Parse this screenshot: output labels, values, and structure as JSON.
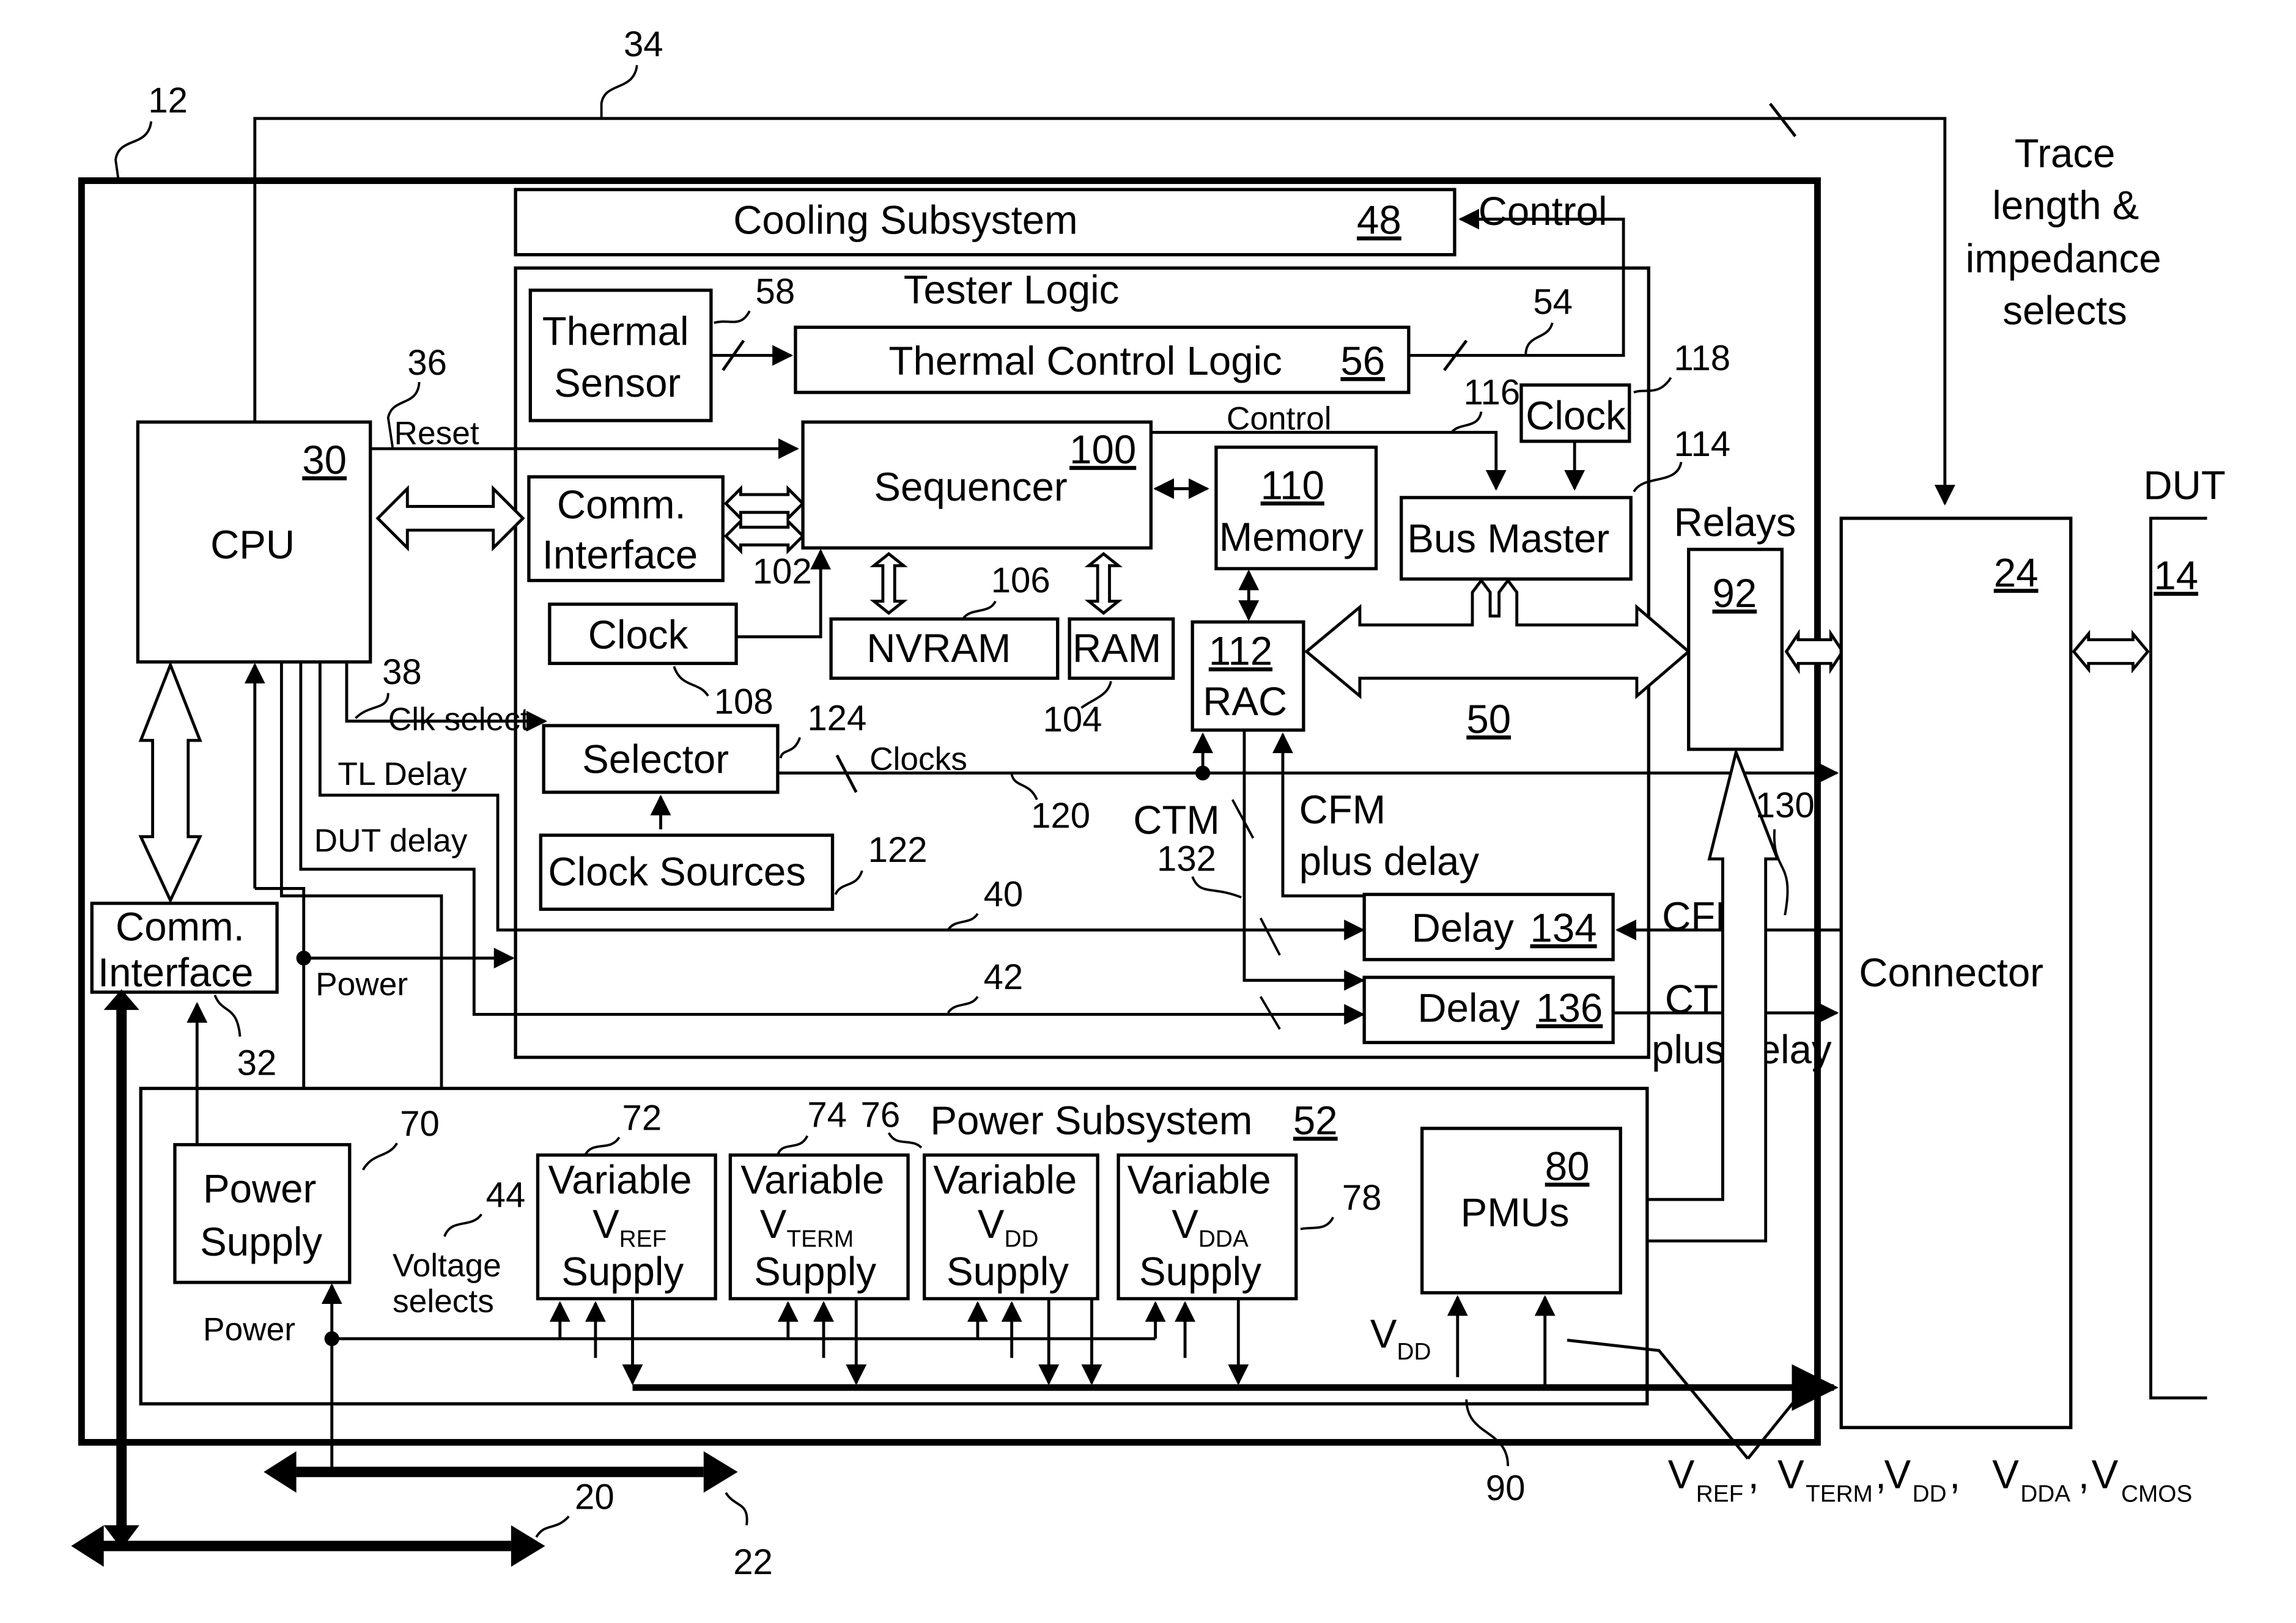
{
  "figure": {
    "refs": {
      "tester": "12",
      "trace_bus": "34",
      "cpu_reset": "36",
      "cpu_sel": "38",
      "tl_delay_line": "40",
      "dut_delay_line": "42",
      "voltage_sel": "44",
      "thermal_sensor": "58",
      "thermal_ctl_line": "54",
      "clock_bus_master": "118",
      "bus_master": "114",
      "control_116": "116",
      "comm_if_inner": "102",
      "nvram": "106",
      "clock_108": "108",
      "ram": "104",
      "selector": "124",
      "clocks_line": "120",
      "clock_sources": "122",
      "ctm_line": "132",
      "cfm_line": "130",
      "comm_if_outer": "32",
      "power_supply": "70",
      "vref": "72",
      "vterm": "74",
      "vdd": "76",
      "vdda": "78",
      "pmu_vdd": "90",
      "bus_a": "20",
      "bus_b": "22",
      "dut": "14"
    },
    "blocks": {
      "cooling": {
        "label": "Cooling Subsystem",
        "num": "48"
      },
      "tester_logic": {
        "label": "Tester Logic",
        "num": "50"
      },
      "thermal_sensor": {
        "line1": "Thermal",
        "line2": "Sensor"
      },
      "thermal_control": {
        "label": "Thermal Control Logic",
        "num": "56"
      },
      "cpu": {
        "label": "CPU",
        "num": "30"
      },
      "comm_inner": {
        "line1": "Comm.",
        "line2": "Interface"
      },
      "sequencer": {
        "label": "Sequencer",
        "num": "100"
      },
      "memory": {
        "label": "Memory",
        "num": "110"
      },
      "clock_bm": {
        "label": "Clock"
      },
      "bus_master": {
        "label": "Bus Master"
      },
      "clock_108": {
        "label": "Clock"
      },
      "nvram": {
        "label": "NVRAM"
      },
      "ram": {
        "label": "RAM"
      },
      "rac": {
        "label": "RAC",
        "num": "112"
      },
      "relays": {
        "label": "Relays",
        "num": "92"
      },
      "connector": {
        "label": "Connector",
        "num": "24"
      },
      "dut": {
        "label": "DUT",
        "num": "14"
      },
      "selector": {
        "label": "Selector"
      },
      "clock_sources": {
        "label": "Clock Sources"
      },
      "delay134": {
        "label": "Delay",
        "num": "134"
      },
      "delay136": {
        "label": "Delay",
        "num": "136"
      },
      "comm_outer": {
        "line1": "Comm.",
        "line2": "Interface"
      },
      "power_subsystem": {
        "label": "Power Subsystem",
        "num": "52"
      },
      "power_supply": {
        "line1": "Power",
        "line2": "Supply"
      },
      "vref_supply": {
        "line1": "Variable",
        "v": "V",
        "sub": "REF",
        "line3": "Supply"
      },
      "vterm_supply": {
        "line1": "Variable",
        "v": "V",
        "sub": "TERM",
        "line3": "Supply"
      },
      "vdd_supply": {
        "line1": "Variable",
        "v": "V",
        "sub": "DD",
        "line3": "Supply"
      },
      "vdda_supply": {
        "line1": "Variable",
        "v": "V",
        "sub": "DDA",
        "line3": "Supply"
      },
      "pmus": {
        "label": "PMUs",
        "num": "80"
      }
    },
    "signals": {
      "control_top": "Control",
      "control_mid": "Control",
      "reset": "Reset",
      "clk_select": "Clk select",
      "tl_delay": "TL Delay",
      "dut_delay": "DUT delay",
      "power_left": "Power",
      "power_bottom": "Power",
      "clocks": "Clocks",
      "ctm": "CTM",
      "cfm_plus": "CFM",
      "cfm_plus2": "plus delay",
      "cfm_right": "CFM",
      "ctm_right": "CTM",
      "ctm_right2": "plus delay",
      "voltage_selects1": "Voltage",
      "voltage_selects2": "selects",
      "trace1": "Trace",
      "trace2": "length &",
      "trace3": "impedance",
      "trace4": "selects",
      "vdd_v": "V",
      "vdd_sub": "DD"
    },
    "rails": [
      {
        "v": "V",
        "sub": "REF",
        "sep": ","
      },
      {
        "v": "V",
        "sub": "TERM",
        "sep": ","
      },
      {
        "v": "V",
        "sub": "DD",
        "sep": ","
      },
      {
        "v": "V",
        "sub": "DDA",
        "sep": ","
      },
      {
        "v": "V",
        "sub": "CMOS",
        "sep": ""
      }
    ]
  }
}
